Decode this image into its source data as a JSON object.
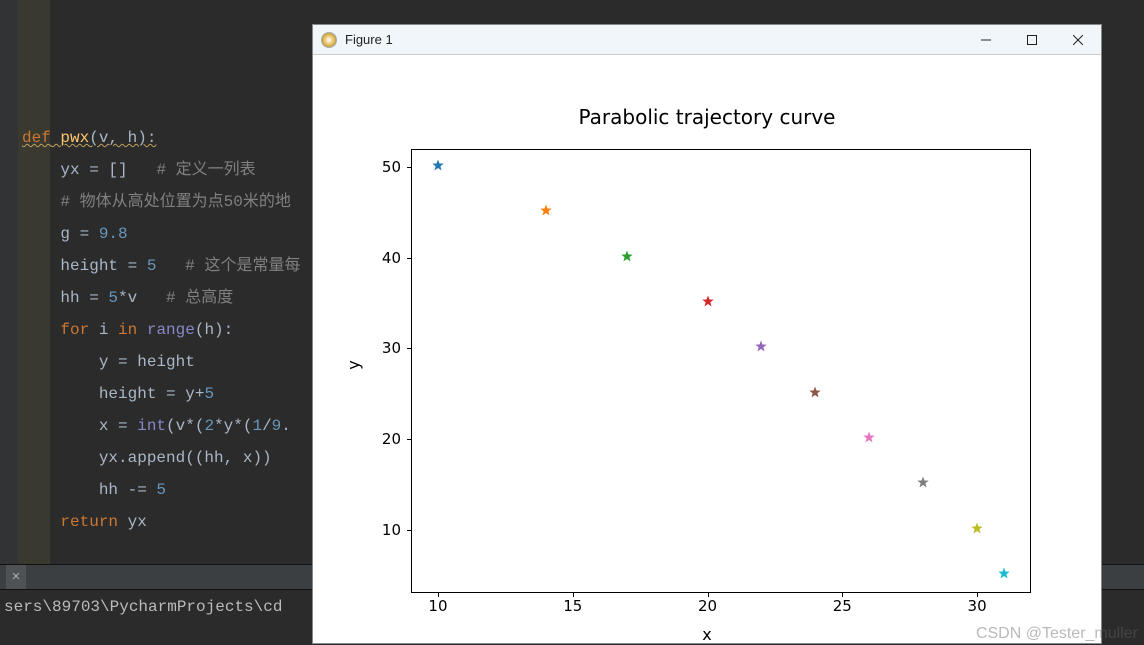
{
  "window": {
    "title": "Figure 1"
  },
  "code": {
    "l1_def": "def",
    "l1_fn": "pwx",
    "l1_params": "(v, h):",
    "l2a": "yx = []",
    "l2c": "# 定义一列表",
    "l3": "# 物体从高处位置为点50米的地",
    "l4a": "g = ",
    "l4n": "9.8",
    "l5a": "height = ",
    "l5n": "5",
    "l5c": "# 这个是常量每",
    "l6a": "hh = ",
    "l6n": "5",
    "l6b": "*v",
    "l6c": "# 总高度",
    "l7a": "for",
    "l7b": " i ",
    "l7c": "in",
    "l7d": " range",
    "l7e": "(h):",
    "l8": "y = height",
    "l9a": "height = y+",
    "l9n": "5",
    "l10a": "x = ",
    "l10b": "int",
    "l10c": "(v*(",
    "l10n1": "2",
    "l10d": "*y*(",
    "l10n2": "1",
    "l10e": "/",
    "l10n3": "9",
    "l10f": ".",
    "l11a": "yx.append((hh, x))",
    "l12a": "hh -= ",
    "l12n": "5",
    "l13a": "return",
    "l13b": " yx"
  },
  "terminal": {
    "close_label": "×",
    "path": "sers\\89703\\PycharmProjects\\cd"
  },
  "watermark": "CSDN @Tester_muller",
  "chart_data": {
    "type": "scatter",
    "title": "Parabolic trajectory curve",
    "xlabel": "x",
    "ylabel": "y",
    "xlim": [
      9,
      32
    ],
    "ylim": [
      3,
      52
    ],
    "xticks": [
      10,
      15,
      20,
      25,
      30
    ],
    "yticks": [
      10,
      20,
      30,
      40,
      50
    ],
    "points": [
      {
        "x": 10,
        "y": 50,
        "color": "#1f77b4"
      },
      {
        "x": 14,
        "y": 45,
        "color": "#ff7f0e"
      },
      {
        "x": 17,
        "y": 40,
        "color": "#2ca02c"
      },
      {
        "x": 20,
        "y": 35,
        "color": "#d62728"
      },
      {
        "x": 22,
        "y": 30,
        "color": "#9467bd"
      },
      {
        "x": 24,
        "y": 25,
        "color": "#8c564b"
      },
      {
        "x": 26,
        "y": 20,
        "color": "#e377c2"
      },
      {
        "x": 28,
        "y": 15,
        "color": "#7f7f7f"
      },
      {
        "x": 30,
        "y": 10,
        "color": "#bcbd22"
      },
      {
        "x": 31,
        "y": 5,
        "color": "#17becf"
      }
    ]
  }
}
